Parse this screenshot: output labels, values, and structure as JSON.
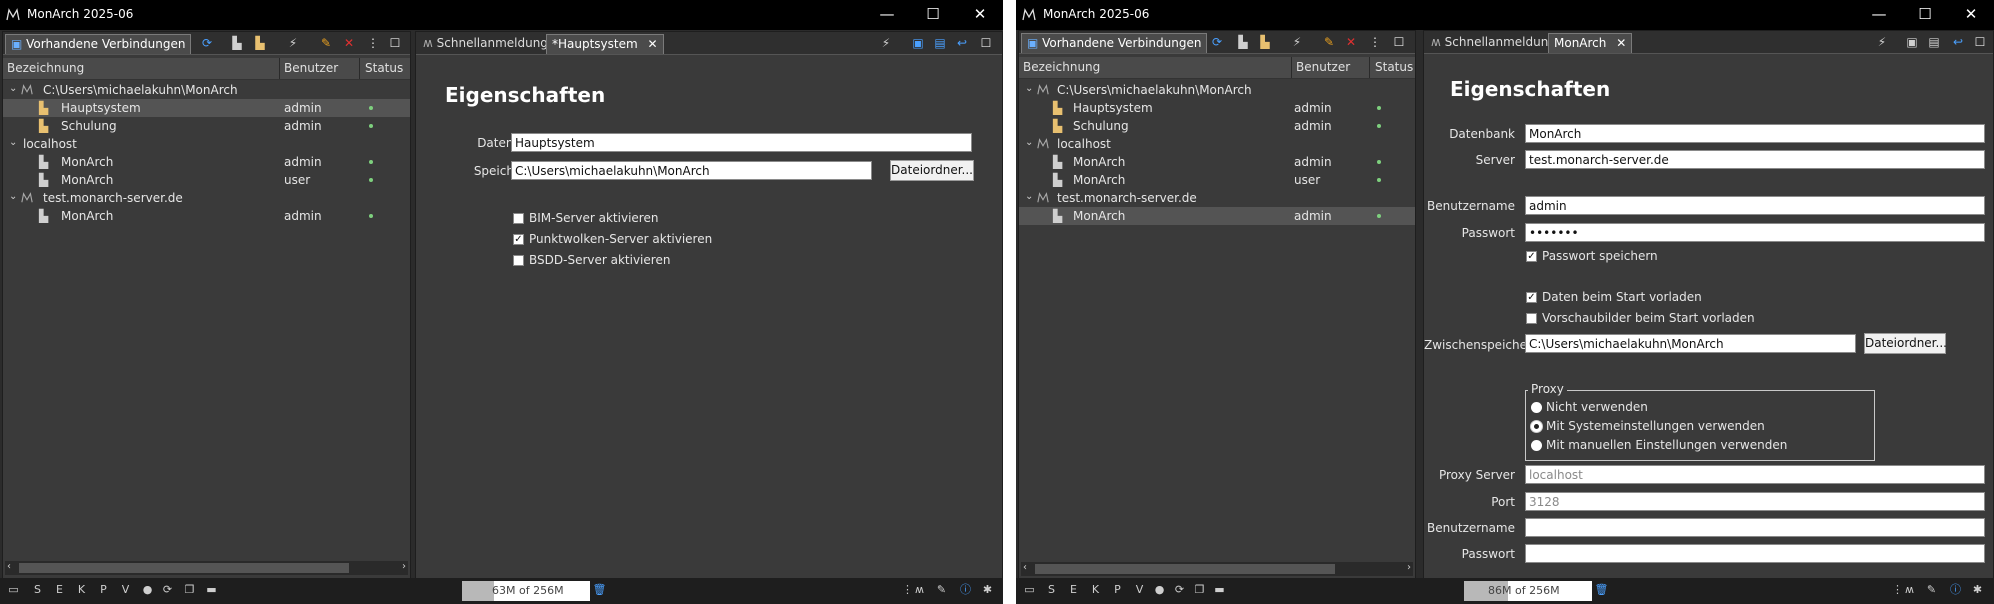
{
  "left": {
    "title": "MonArch 2025-06",
    "conn_tab": "Vorhandene Verbindungen",
    "columns": {
      "name": "Bezeichnung",
      "user": "Benutzer",
      "status": "Status"
    },
    "tree": [
      {
        "label": "C:\\Users\\michaelakuhn\\MonArch",
        "user": "",
        "status": ""
      },
      {
        "label": "Hauptsystem",
        "user": "admin",
        "status": "•"
      },
      {
        "label": "Schulung",
        "user": "admin",
        "status": "•"
      },
      {
        "label": "localhost",
        "user": "",
        "status": ""
      },
      {
        "label": "MonArch",
        "user": "admin",
        "status": "•"
      },
      {
        "label": "MonArch",
        "user": "user",
        "status": "•"
      },
      {
        "label": "test.monarch-server.de",
        "user": "",
        "status": ""
      },
      {
        "label": "MonArch",
        "user": "admin",
        "status": "•"
      }
    ],
    "editor_tabs": {
      "quick": "Schnellanmeldung",
      "active": "*Hauptsystem"
    },
    "heading": "Eigenschaften",
    "form": {
      "db_label": "Datenbank",
      "db_value": "Hauptsystem",
      "loc_label": "Speicherort",
      "loc_value": "C:\\Users\\michaelakuhn\\MonArch",
      "folder_btn": "Dateiordner...",
      "cb1": "BIM-Server aktivieren",
      "cb2": "Punktwolken-Server aktivieren",
      "cb3": "BSDD-Server aktivieren"
    },
    "memory": {
      "text": "63M of 256M",
      "fraction": 0.25
    }
  },
  "right": {
    "title": "MonArch 2025-06",
    "conn_tab": "Vorhandene Verbindungen",
    "columns": {
      "name": "Bezeichnung",
      "user": "Benutzer",
      "status": "Status"
    },
    "tree": [
      {
        "label": "C:\\Users\\michaelakuhn\\MonArch",
        "user": "",
        "status": ""
      },
      {
        "label": "Hauptsystem",
        "user": "admin",
        "status": "•"
      },
      {
        "label": "Schulung",
        "user": "admin",
        "status": "•"
      },
      {
        "label": "localhost",
        "user": "",
        "status": ""
      },
      {
        "label": "MonArch",
        "user": "admin",
        "status": "•"
      },
      {
        "label": "MonArch",
        "user": "user",
        "status": "•"
      },
      {
        "label": "test.monarch-server.de",
        "user": "",
        "status": ""
      },
      {
        "label": "MonArch",
        "user": "admin",
        "status": "•"
      }
    ],
    "editor_tabs": {
      "quick": "Schnellanmeldung",
      "active": "MonArch"
    },
    "heading": "Eigenschaften",
    "form": {
      "db_label": "Datenbank",
      "db_value": "MonArch",
      "server_label": "Server",
      "server_value": "test.monarch-server.de",
      "user_label": "Benutzername",
      "user_value": "admin",
      "pw_label": "Passwort",
      "pw_value": "•••••••",
      "save_pw": "Passwort speichern",
      "preload": "Daten beim Start vorladen",
      "preview": "Vorschaubilder beim Start vorladen",
      "cache_label": "Zwischenspeicher",
      "cache_value": "C:\\Users\\michaelakuhn\\MonArch",
      "folder_btn": "Dateiordner...",
      "proxy_legend": "Proxy",
      "proxy_opt1": "Nicht verwenden",
      "proxy_opt2": "Mit Systemeinstellungen verwenden",
      "proxy_opt3": "Mit manuellen Einstellungen verwenden",
      "proxy_server_label": "Proxy Server",
      "proxy_server_value": "localhost",
      "port_label": "Port",
      "port_value": "3128",
      "puser_label": "Benutzername",
      "puser_value": "",
      "ppw_label": "Passwort",
      "ppw_value": ""
    },
    "memory": {
      "text": "86M of 256M",
      "fraction": 0.34
    }
  },
  "colors": {
    "accent": "#2f7fd8",
    "status_dot": "#7ed07e",
    "delete": "#e03030",
    "pencil": "#e8a020"
  }
}
